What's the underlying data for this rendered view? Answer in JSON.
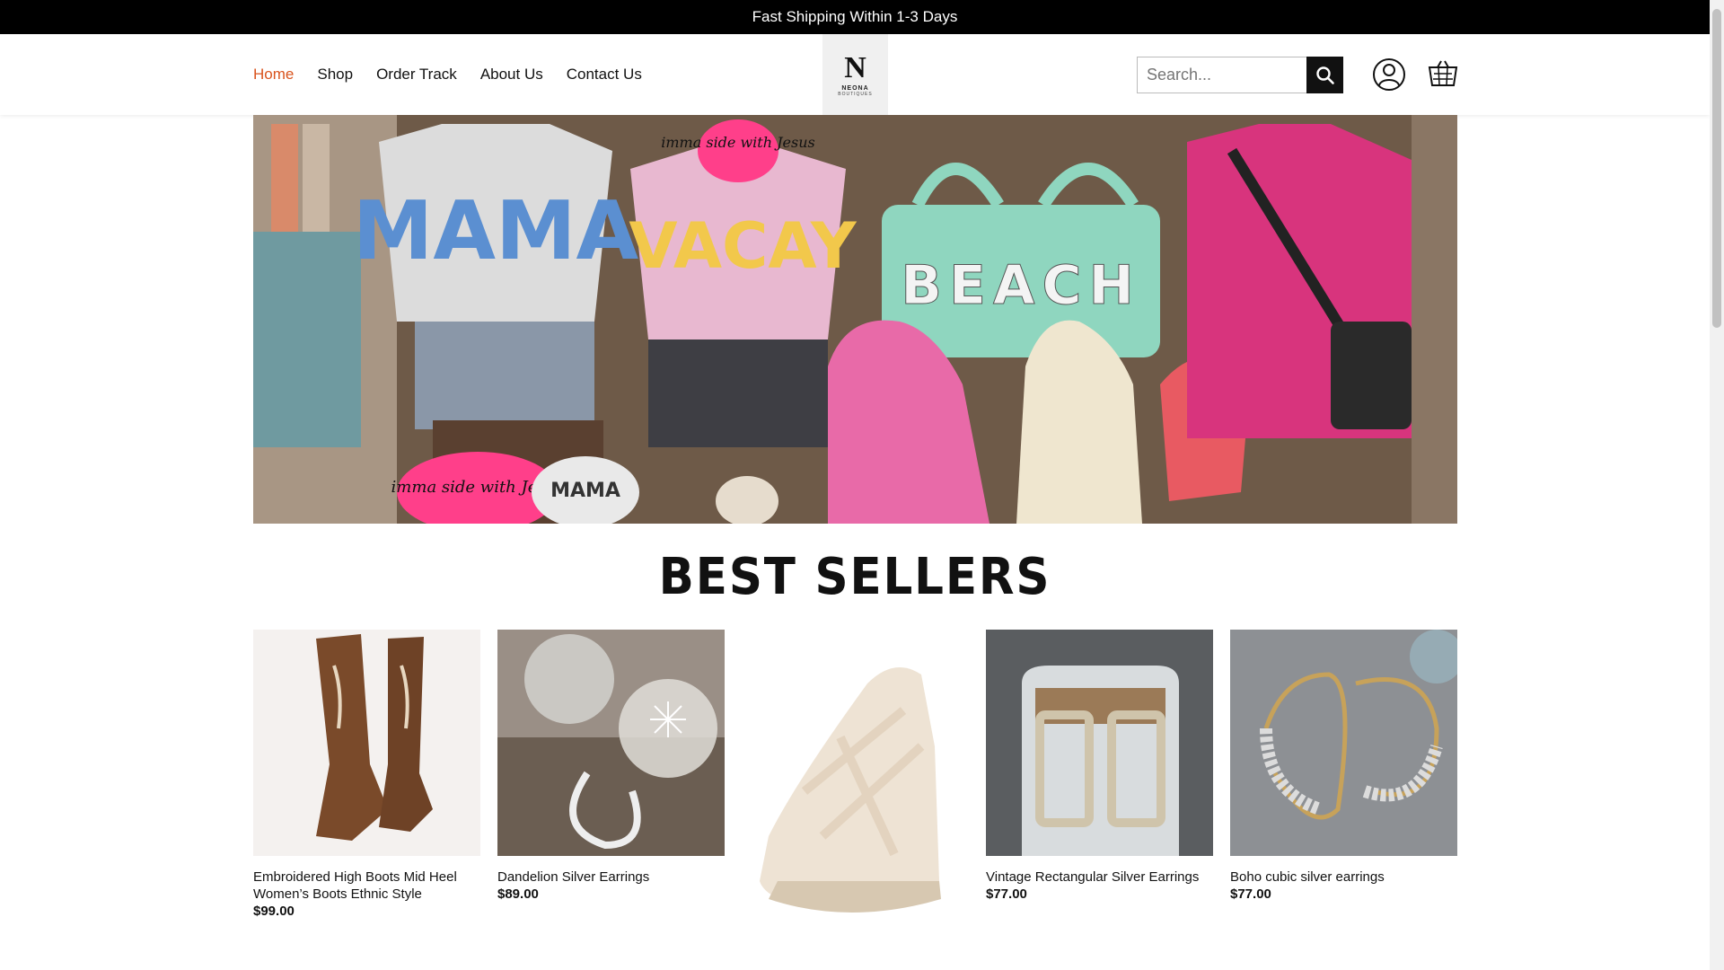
{
  "announcement": "Fast Shipping Within 1-3 Days",
  "nav": {
    "items": [
      {
        "label": "Home",
        "active": true
      },
      {
        "label": "Shop"
      },
      {
        "label": "Order Track"
      },
      {
        "label": "About Us"
      },
      {
        "label": "Contact Us"
      }
    ]
  },
  "logo": {
    "letter": "N",
    "brand": "NEONA",
    "sub": "BOUTIQUES"
  },
  "search": {
    "placeholder": "Search..."
  },
  "icons": {
    "search": "search-icon",
    "account": "user-icon",
    "cart": "cart-icon"
  },
  "colors": {
    "accent": "#d9541e",
    "topbar": "#000000"
  },
  "hero": {
    "texts": {
      "mama_shirt": "MAMA",
      "vacay_shirt": "VACAY",
      "beach_bag": "BEACH",
      "hat1": "imma side with Jesus",
      "hat2": "imma side with Jesus",
      "hat3": "MAMA"
    }
  },
  "best_sellers": {
    "title": "BEST SELLERS",
    "products": [
      {
        "name": "Embroidered High Boots Mid Heel Women’s Boots Ethnic Style",
        "price": "$99.00"
      },
      {
        "name": "Dandelion Silver Earrings",
        "price": "$89.00"
      },
      {
        "name": "",
        "price": ""
      },
      {
        "name": "Vintage Rectangular Silver Earrings",
        "price": "$77.00"
      },
      {
        "name": "Boho cubic silver earrings",
        "price": "$77.00"
      }
    ]
  }
}
